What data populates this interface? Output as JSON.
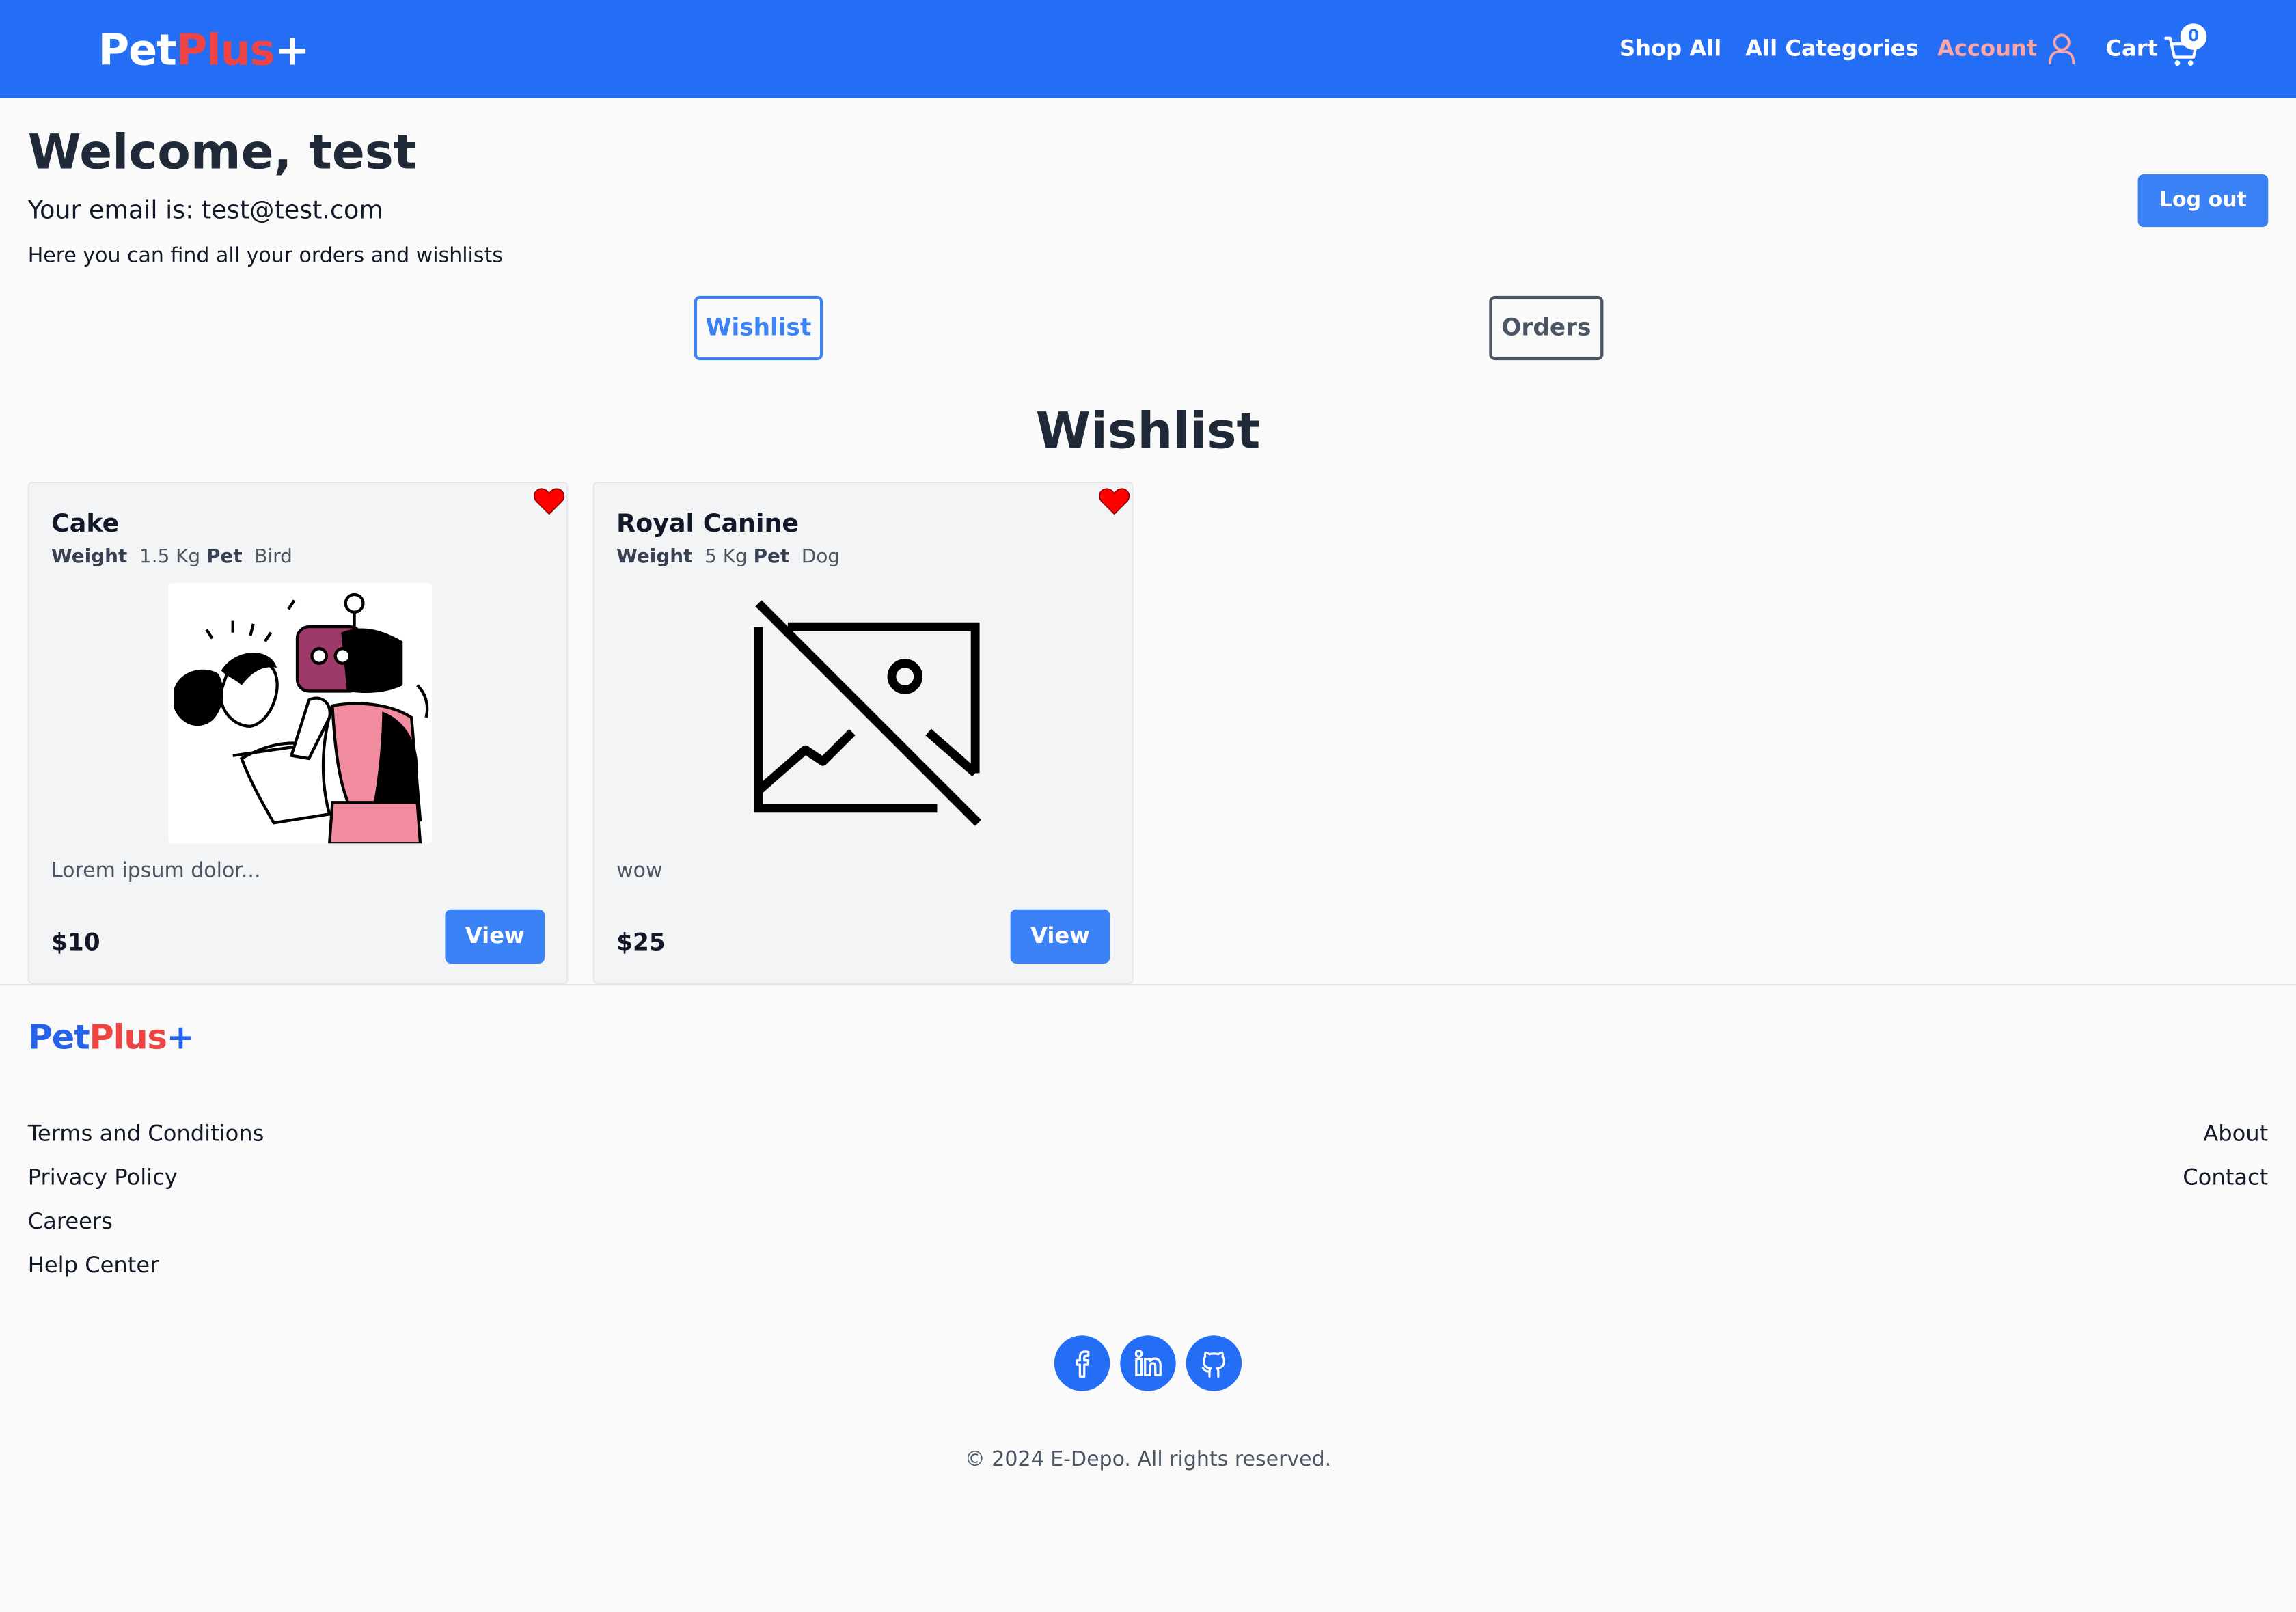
{
  "brand": {
    "logo_part1": "Pet",
    "logo_part2": "Plus",
    "logo_part3": "+"
  },
  "nav": {
    "shop_all": "Shop All",
    "all_categories": "All Categories",
    "account": "Account",
    "cart": "Cart",
    "cart_count": "0"
  },
  "account": {
    "welcome": "Welcome, test",
    "email_line": "Your email is: test@test.com",
    "description": "Here you can find all your orders and wishlists",
    "logout_label": "Log out"
  },
  "tabs": {
    "wishlist_label": "Wishlist",
    "orders_label": "Orders",
    "active": "Wishlist"
  },
  "wishlist": {
    "title": "Wishlist",
    "items": [
      {
        "name": "Cake",
        "weight_label": "Weight",
        "weight": "1.5 Kg",
        "pet_label": "Pet",
        "pet": "Bird",
        "description": "Lorem ipsum dolor...",
        "price": "$10",
        "button_label": "View",
        "image_icon": "person-with-robot-illustration",
        "favorite": true
      },
      {
        "name": "Royal Canine",
        "weight_label": "Weight",
        "weight": "5 Kg",
        "pet_label": "Pet",
        "pet": "Dog",
        "description": "wow",
        "price": "$25",
        "button_label": "View",
        "image_icon": "image-unavailable-icon",
        "favorite": true
      }
    ]
  },
  "footer": {
    "links_left": [
      "Terms and Conditions",
      "Privacy Policy",
      "Careers",
      "Help Center"
    ],
    "links_right": [
      "About",
      "Contact"
    ],
    "social": [
      "facebook-icon",
      "linkedin-icon",
      "github-icon"
    ],
    "copyright": "© 2024 E-Depo. All rights reserved."
  },
  "colors": {
    "header": "#246ef5",
    "button_primary": "#3b82f6",
    "brand_plus": "#ef4444",
    "account_active": "#fca5a5",
    "heart": "#ff0000"
  }
}
